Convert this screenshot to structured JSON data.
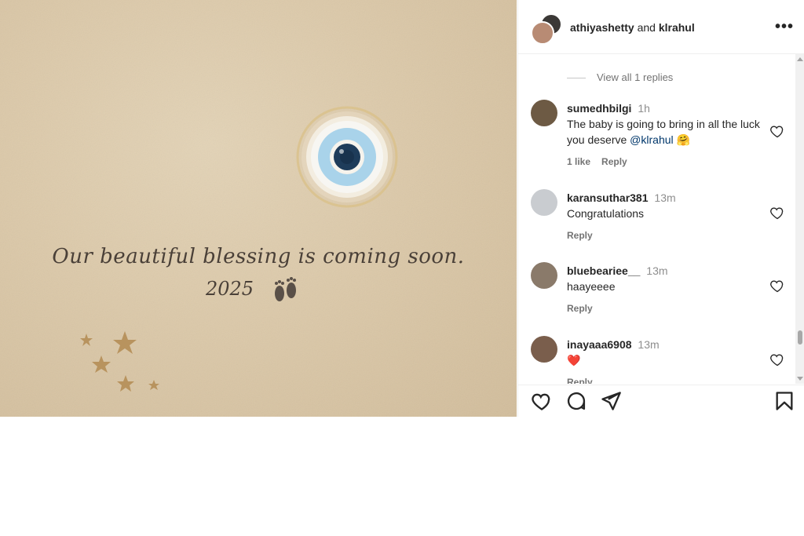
{
  "media": {
    "caption_line1": "Our beautiful blessing is coming soon.",
    "caption_line2": "2025",
    "footprints_icon": "footprints-emoji",
    "evil_eye_icon": "evil-eye-charm",
    "stars_icon": "star-doodles"
  },
  "header": {
    "user1": "athiyashetty",
    "connector": " and ",
    "user2": "klrahul",
    "more_icon": "more-options-icon"
  },
  "comments": {
    "view_replies": "View all 1 replies",
    "items": [
      {
        "username": "sumedhbilgi",
        "time": "1h",
        "text_before": "The baby is going to bring in all the luck you deserve ",
        "mention": "@klrahul",
        "emoji": "🤗",
        "likes": "1 like",
        "reply": "Reply",
        "avatar_color": "#6d5a44"
      },
      {
        "username": "karansuthar381",
        "time": "13m",
        "text": "Congratulations",
        "reply": "Reply",
        "avatar_color": "#c9ccd0"
      },
      {
        "username": "bluebeariee__",
        "time": "13m",
        "text": "haayeeee",
        "reply": "Reply",
        "avatar_color": "#8a7a6a"
      },
      {
        "username": "inayaaa6908",
        "time": "13m",
        "text": "❤️",
        "reply": "Reply",
        "avatar_color": "#7a5e4c"
      }
    ]
  },
  "actions": {
    "like": "heart-icon",
    "comment": "comment-icon",
    "share": "share-icon",
    "save": "bookmark-icon"
  },
  "colors": {
    "mention": "#00376b",
    "meta": "#737373",
    "heart": "#e0245e"
  }
}
